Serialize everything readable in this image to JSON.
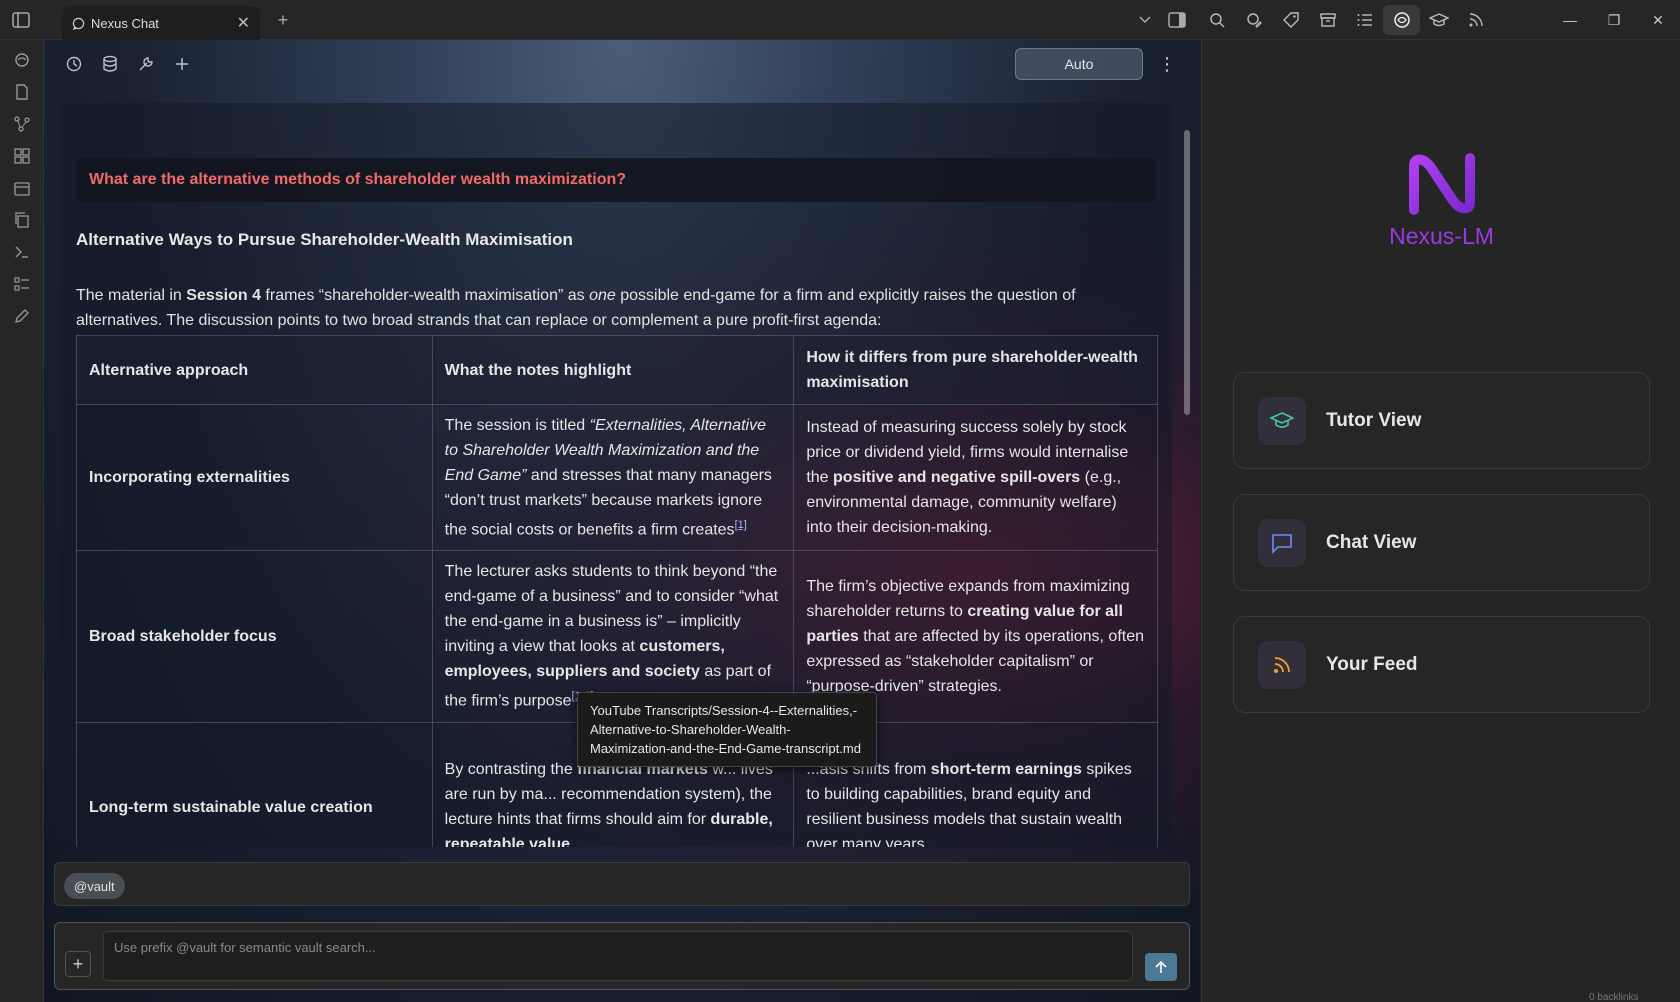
{
  "titlebar": {
    "tab_label": "Nexus Chat"
  },
  "toolbar": {
    "mode_label": "Auto"
  },
  "chat": {
    "question": "What are the alternative methods of shareholder wealth maximization?",
    "answer_title": "Alternative Ways to Pursue Shareholder-Wealth Maximisation",
    "intro_a": "The material in ",
    "intro_session": "Session 4",
    "intro_b": " frames “shareholder-wealth maximisation” as ",
    "intro_one": "one",
    "intro_c": " possible end-game for a firm and explicitly raises the question of alternatives. The discussion points to two broad strands that can replace or complement a pure profit-first agenda:",
    "table": {
      "headers": [
        "Alternative approach",
        "What the notes highlight",
        "How it differs from pure shareholder-wealth maximisation"
      ],
      "rows": [
        {
          "approach": "Incorporating externalities",
          "notes_a": "The session is titled ",
          "notes_italic": "“Externalities, Alternative to Shareholder Wealth Maximization and the End Game”",
          "notes_b": " and stresses that many managers “don’t trust markets” because markets ignore the social costs or benefits a firm creates",
          "notes_cite": "[1]",
          "diff_a": "Instead of measuring success solely by stock price or dividend yield, firms would internalise the ",
          "diff_bold": "positive and negative spill-overs",
          "diff_b": " (e.g., environmental damage, community welfare) into their decision-making."
        },
        {
          "approach": "Broad stakeholder focus",
          "notes_a": "The lecturer asks students to think beyond “the end-game of a business” and to consider “what the end-game in a business is” – implicitly inviting a view that looks at ",
          "notes_bold": "customers, employees, suppliers and society",
          "notes_b": " as part of the firm’s purpose",
          "notes_cite": "[1-1]",
          "diff_a": "The firm’s objective expands from maximizing shareholder returns to ",
          "diff_bold": "creating value for all parties",
          "diff_b": " that are affected by its operations, often expressed as “stakeholder capitalism” or “purpose-driven” strategies."
        },
        {
          "approach": "Long-term sustainable value creation",
          "notes_a": "By contrasting the ",
          "notes_bold": "financial markets",
          "notes_b": " w... lives are run by ma... recommendation system), the lecture hints that firms should aim for ",
          "notes_bold2": "durable, repeatable value",
          "diff_a": "...asis shifts from ",
          "diff_bold": "short-term earnings",
          "diff_b": " spikes to building capabilities, brand equity and resilient business models that sustain wealth over many years."
        }
      ]
    },
    "tooltip": "YouTube Transcripts/Session-4--Externalities,-Alternative-to-Shareholder-Wealth-Maximization-and-the-End-Game-transcript.md"
  },
  "input": {
    "vault_chip": "@vault",
    "placeholder": "Use prefix @vault for semantic vault search..."
  },
  "right_panel": {
    "logo_name": "Nexus-LM",
    "cards": [
      {
        "label": "Tutor View",
        "icon": "graduation-cap-icon",
        "color": "#3ec9a7"
      },
      {
        "label": "Chat View",
        "icon": "chat-bubble-icon",
        "color": "#6e8cf5"
      },
      {
        "label": "Your Feed",
        "icon": "rss-icon",
        "color": "#f0a030"
      }
    ],
    "backlinks": "0 backlinks"
  },
  "colors": {
    "question_text": "#f06a6a",
    "brand": "#9b3ae0"
  }
}
